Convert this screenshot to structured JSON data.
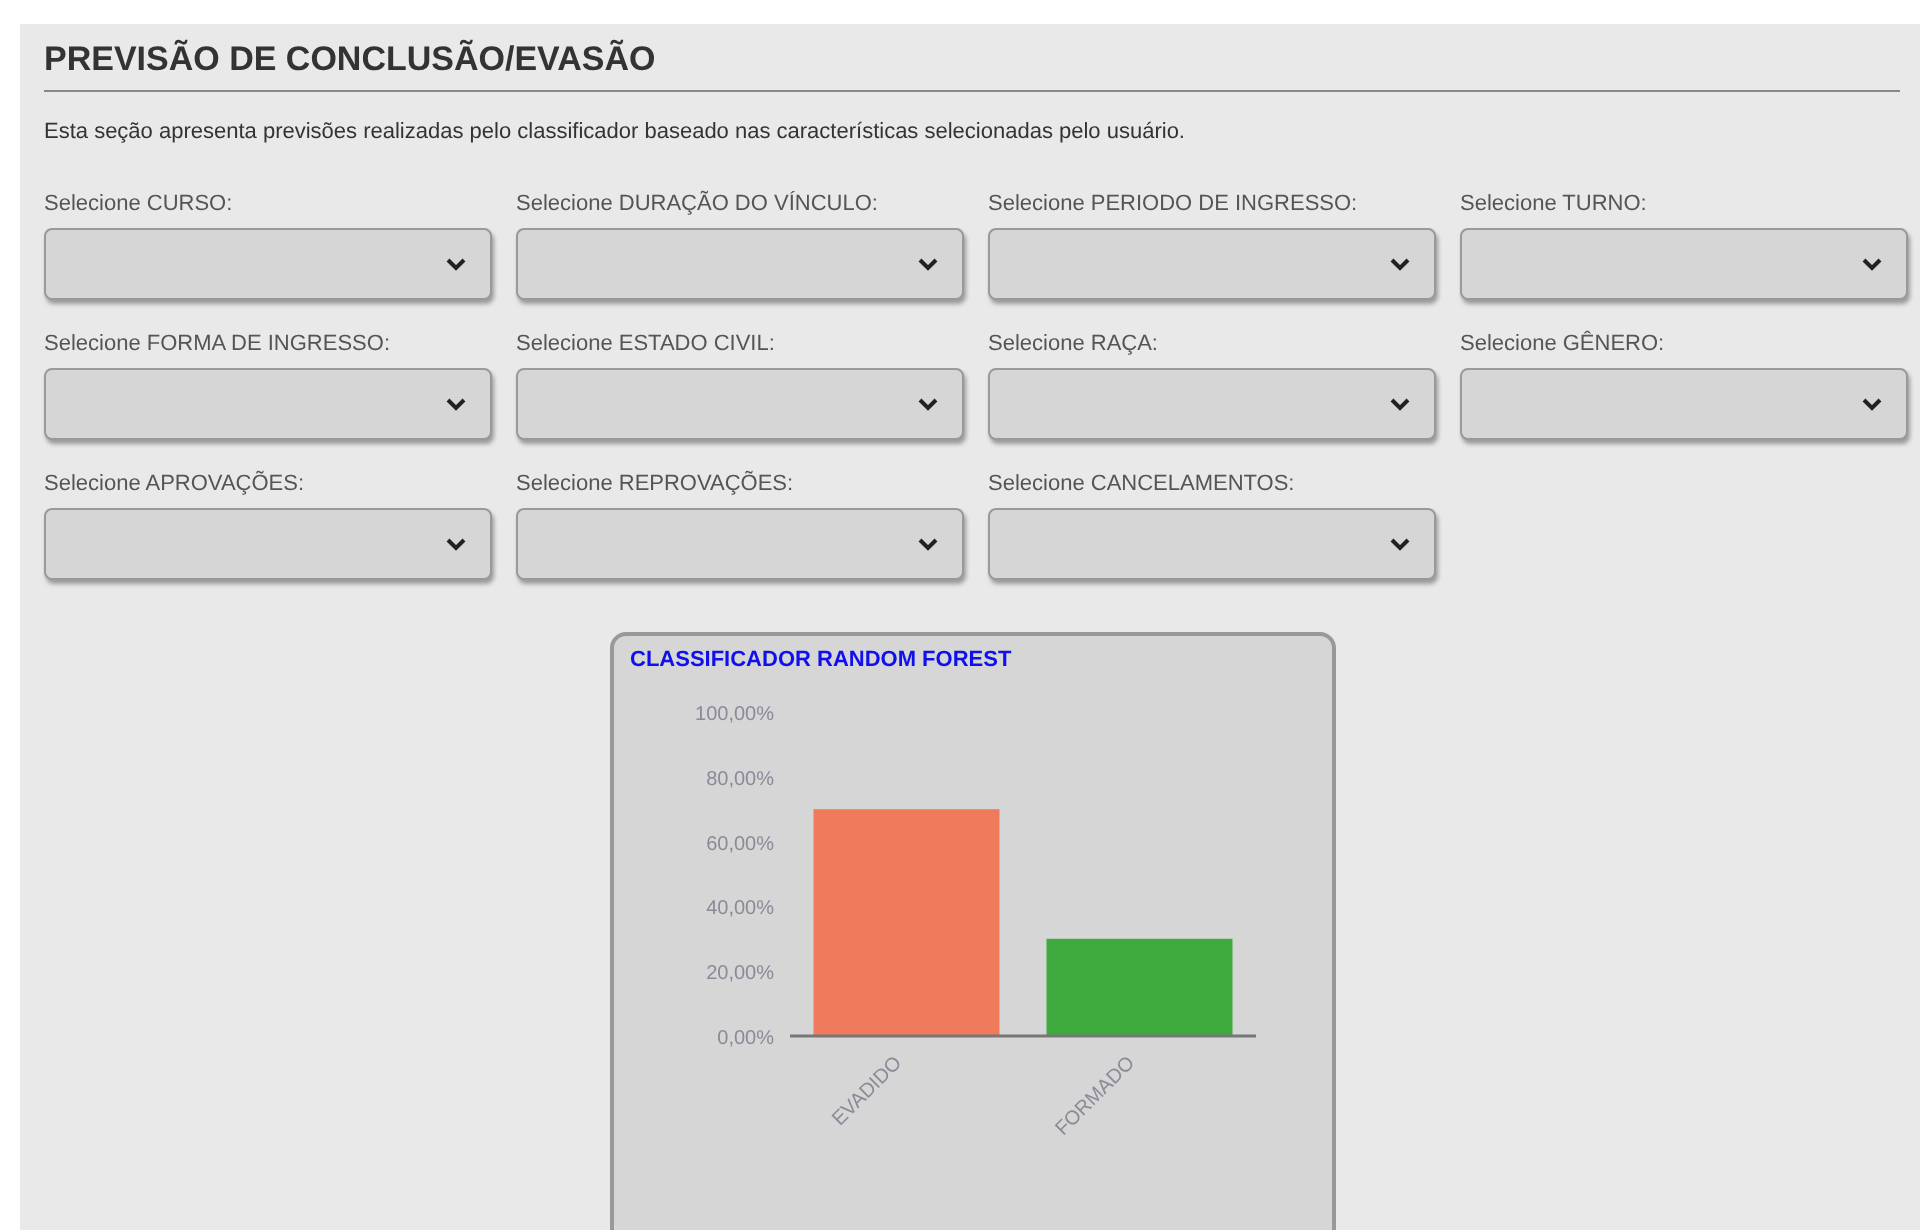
{
  "section": {
    "title": "PREVISÃO DE CONCLUSÃO/EVASÃO",
    "description": "Esta seção apresenta previsões realizadas pelo classificador baseado nas características selecionadas pelo usuário."
  },
  "filters": [
    {
      "label": "Selecione CURSO:"
    },
    {
      "label": "Selecione DURAÇÃO DO VÍNCULO:"
    },
    {
      "label": "Selecione PERIODO DE INGRESSO:"
    },
    {
      "label": "Selecione TURNO:"
    },
    {
      "label": "Selecione FORMA DE INGRESSO:"
    },
    {
      "label": "Selecione ESTADO CIVIL:"
    },
    {
      "label": "Selecione RAÇA:"
    },
    {
      "label": "Selecione GÊNERO:"
    },
    {
      "label": "Selecione APROVAÇÕES:"
    },
    {
      "label": "Selecione REPROVAÇÕES:"
    },
    {
      "label": "Selecione CANCELAMENTOS:"
    }
  ],
  "chart_card": {
    "title": "CLASSIFICADOR RANDOM FOREST",
    "chart_data": {
      "type": "bar",
      "series": [
        {
          "name": "EVADIDO",
          "color": "#ef7a5c",
          "values": [
            70,
            null
          ]
        },
        {
          "name": "FORMADO",
          "color": "#3eaa3e",
          "values": [
            null,
            30
          ]
        }
      ],
      "ylim": [
        0,
        100
      ],
      "yticks": [
        {
          "value": 0,
          "label": "0,00%"
        },
        {
          "value": 20,
          "label": "20,00%"
        },
        {
          "value": 40,
          "label": "40,00%"
        },
        {
          "value": 60,
          "label": "60,00%"
        },
        {
          "value": 80,
          "label": "80,00%"
        },
        {
          "value": 100,
          "label": "100,00%"
        }
      ]
    }
  }
}
